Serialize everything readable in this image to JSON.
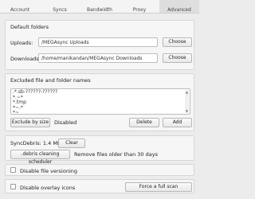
{
  "tabs": [
    {
      "label": "Account"
    },
    {
      "label": "Syncs"
    },
    {
      "label": "Bandwidth"
    },
    {
      "label": "Proxy"
    },
    {
      "label": "Advanced",
      "active": true
    }
  ],
  "default_folders": {
    "title": "Default folders",
    "uploads_label": "Uploads:",
    "uploads_value": "/MEGAsync Uploads",
    "downloads_label": "Downloads:",
    "downloads_value": "/home/manikandan/MEGAsync Downloads",
    "choose_label": "Choose"
  },
  "excluded": {
    "title": "Excluded file and folder names",
    "items": [
      ".*.sb-??????-??????",
      "*.~*",
      "*.tmp",
      "*~.*",
      "*~"
    ],
    "exclude_by_size_label": "Exclude by size",
    "exclude_by_size_status": "Disabled",
    "delete_label": "Delete",
    "add_label": "Add"
  },
  "debris": {
    "size_text": "SyncDebris: 1.4 MB",
    "clear_label": "Clear",
    "scheduler_label": ".debris cleaning scheduler",
    "scheduler_text": "Remove files older than 30 days"
  },
  "versioning": {
    "label": "Disable file versioning"
  },
  "overlay": {
    "label": "Disable overlay icons",
    "full_scan_label": "Force a full scan"
  }
}
